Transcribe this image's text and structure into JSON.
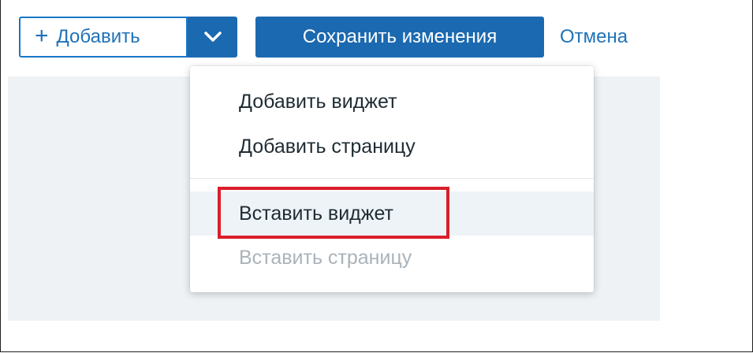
{
  "toolbar": {
    "add_label": "Добавить",
    "add_icon": "plus-icon",
    "dropdown_icon": "chevron-down-icon",
    "save_label": "Сохранить изменения",
    "cancel_label": "Отмена"
  },
  "menu": {
    "items": [
      {
        "label": "Добавить виджет",
        "enabled": true
      },
      {
        "label": "Добавить страницу",
        "enabled": true
      },
      {
        "label": "Вставить виджет",
        "enabled": true,
        "highlighted": true
      },
      {
        "label": "Вставить страницу",
        "enabled": false
      }
    ]
  },
  "colors": {
    "primary": "#1b69b0",
    "link": "#1f72b8",
    "highlight": "#d91e2a",
    "canvas": "#eef2f5",
    "disabled": "#a9b3ba"
  }
}
